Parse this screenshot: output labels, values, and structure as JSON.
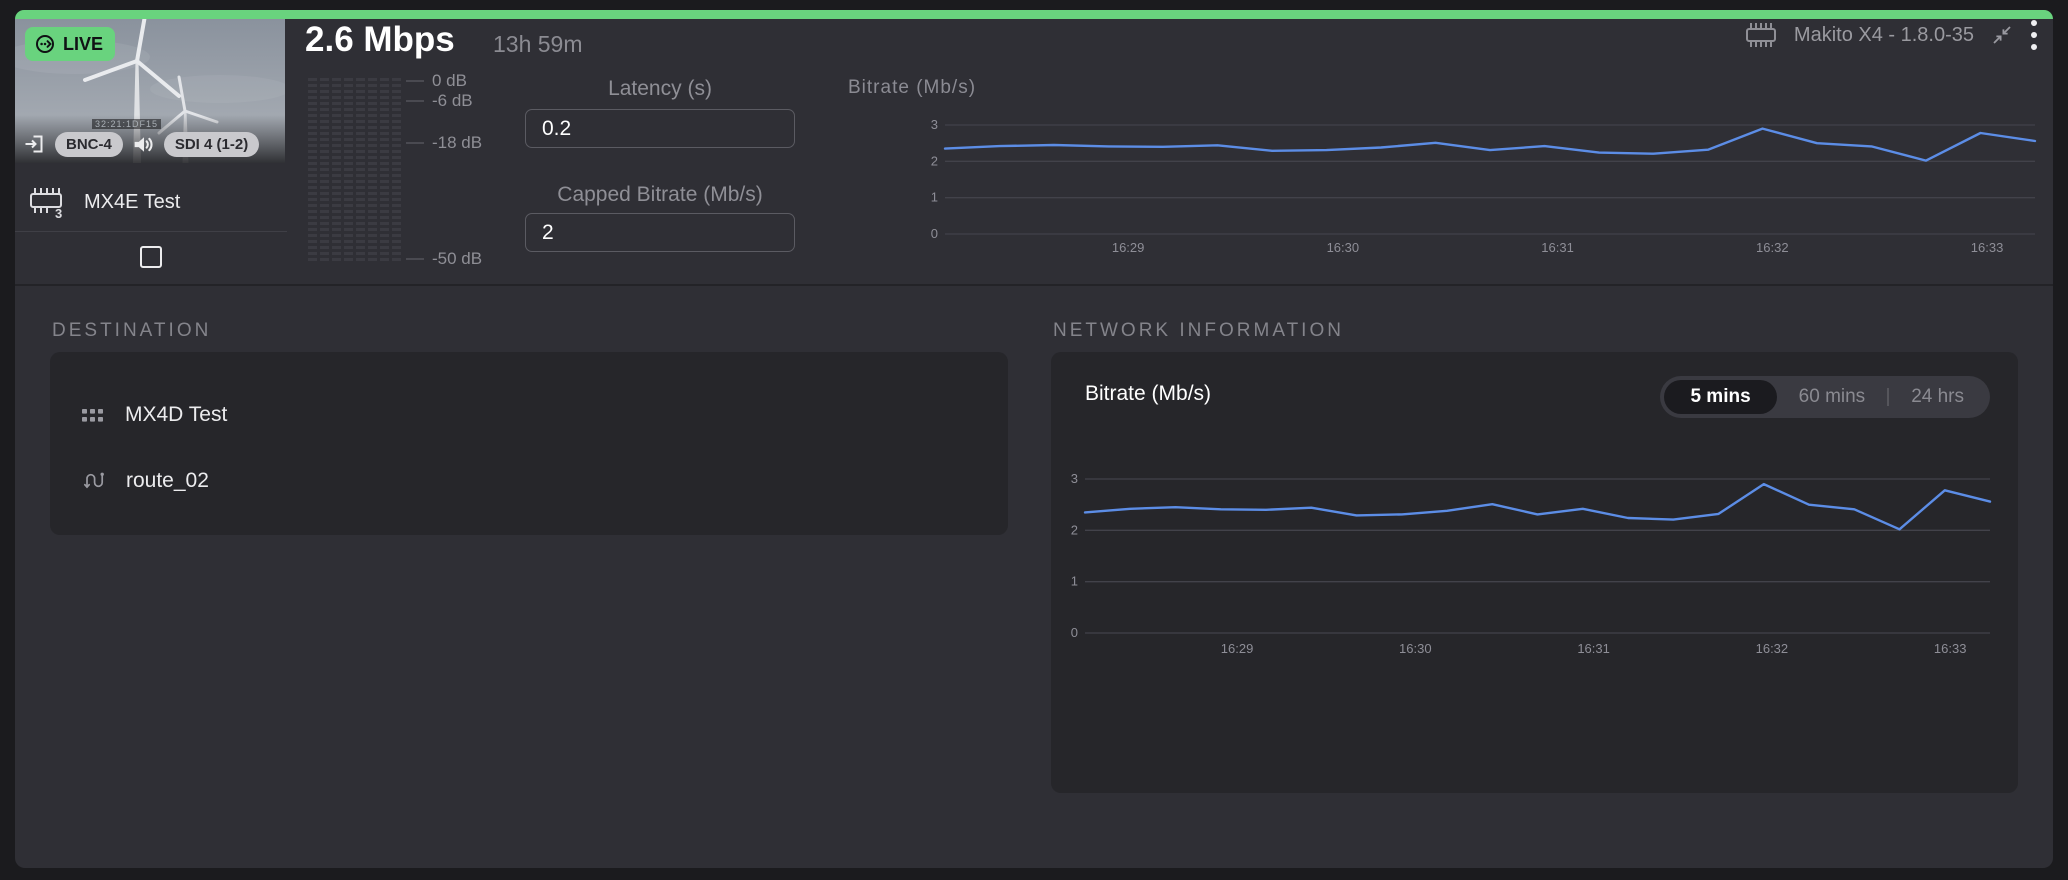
{
  "header": {
    "live_label": "LIVE",
    "bitrate_value": "2.6 Mbps",
    "uptime": "13h 59m",
    "device_label": "Makito X4 - 1.8.0-35",
    "encoder_name": "MX4E Test",
    "encoder_channel": "3",
    "input_badge": "BNC-4",
    "audio_badge": "SDI 4 (1-2)",
    "thumbnail_overlay_text": "32:21:1DF15"
  },
  "audio_meter": {
    "labels": [
      "0 dB",
      "-6 dB",
      "-18 dB",
      "-50 dB"
    ]
  },
  "controls": {
    "latency": {
      "label": "Latency (s)",
      "value": "0.2"
    },
    "capped_bitrate": {
      "label": "Capped Bitrate (Mb/s)",
      "value": "2"
    }
  },
  "destination": {
    "heading": "DESTINATION",
    "items": [
      {
        "name": "MX4D Test",
        "icon": "grid-icon"
      },
      {
        "name": "route_02",
        "icon": "route-icon"
      }
    ]
  },
  "network": {
    "heading": "NETWORK INFORMATION",
    "chart_title": "Bitrate (Mb/s)",
    "range_options": [
      "5 mins",
      "60 mins",
      "24 hrs"
    ],
    "selected_range": "5 mins"
  },
  "colors": {
    "accent_green": "#69d37e",
    "chart_line": "#5c8de6",
    "grid": "#42424a",
    "tick_text": "#8e8e97"
  },
  "chart_data": [
    {
      "type": "line",
      "title": "Bitrate (Mb/s)",
      "x_labels": [
        "16:29",
        "16:30",
        "16:31",
        "16:32",
        "16:33"
      ],
      "x_label_fractions": [
        0.168,
        0.365,
        0.562,
        0.759,
        0.956
      ],
      "yticks": [
        0,
        1,
        2,
        3
      ],
      "ylim": [
        0,
        3.5
      ],
      "values": [
        2.35,
        2.42,
        2.45,
        2.41,
        2.4,
        2.44,
        2.29,
        2.31,
        2.38,
        2.51,
        2.31,
        2.42,
        2.24,
        2.21,
        2.32,
        2.9,
        2.5,
        2.41,
        2.02,
        2.78,
        2.56
      ],
      "line_color": "#5c8de6",
      "legend": "none",
      "grid": "horizontal"
    },
    {
      "type": "line",
      "title": "Bitrate (Mb/s)",
      "x_labels": [
        "16:29",
        "16:30",
        "16:31",
        "16:32",
        "16:33"
      ],
      "x_label_fractions": [
        0.168,
        0.365,
        0.562,
        0.759,
        0.956
      ],
      "yticks": [
        0,
        1,
        2,
        3
      ],
      "ylim": [
        0,
        3.5
      ],
      "values": [
        2.35,
        2.42,
        2.45,
        2.41,
        2.4,
        2.44,
        2.29,
        2.31,
        2.38,
        2.51,
        2.31,
        2.42,
        2.24,
        2.21,
        2.32,
        2.9,
        2.5,
        2.41,
        2.02,
        2.78,
        2.56
      ],
      "line_color": "#5c8de6",
      "legend": "none",
      "grid": "horizontal"
    }
  ]
}
